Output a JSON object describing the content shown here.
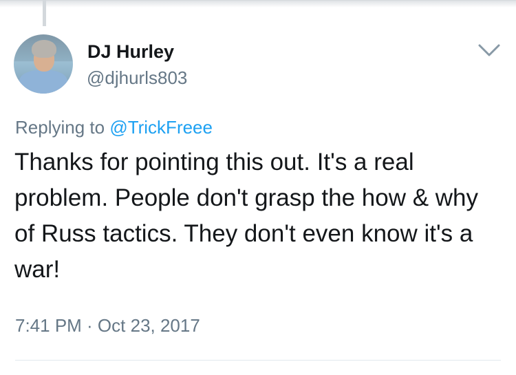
{
  "tweet": {
    "author": {
      "display_name": "DJ Hurley",
      "handle": "@djhurls803"
    },
    "replying": {
      "prefix": "Replying to",
      "mention": "@TrickFreee"
    },
    "text": "Thanks for pointing this out. It's a real problem. People don't grasp the how & why of Russ tactics. They don't even know it's a war!",
    "timestamp": "7:41 PM · Oct 23, 2017"
  },
  "icons": {
    "menu": "chevron-down-icon"
  },
  "colors": {
    "primary_text": "#14171a",
    "secondary_text": "#657786",
    "link": "#1da1f2",
    "divider": "#e1e8ed"
  }
}
